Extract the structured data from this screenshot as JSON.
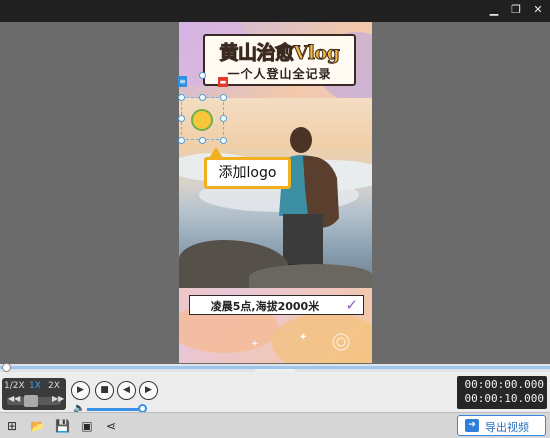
{
  "window": {
    "controls": {
      "minimize_icon": "minimize-icon",
      "restore_icon": "restore-icon",
      "close_icon": "close-icon"
    }
  },
  "canvas": {
    "title_main": "黄山治愈Vlog",
    "title_sub": "一个人登山全记录",
    "caption": "凌晨5点,海拔2000米",
    "tooltip": "添加logo",
    "colors": {
      "title_fill": "#f7b73a",
      "tooltip_border": "#f2b01e",
      "check": "#8a5fb8"
    }
  },
  "playback": {
    "speeds": [
      "1/2X",
      "1X",
      "2X"
    ],
    "active_speed": "1X",
    "volume_level": 1.0,
    "timecode": {
      "current": "00:00:00.000",
      "total": "00:00:10.000"
    }
  },
  "toolbar": {
    "export_label": "导出视频",
    "icons": [
      "crop-icon",
      "folder-icon",
      "save-icon",
      "save-as-icon",
      "share-icon"
    ]
  }
}
